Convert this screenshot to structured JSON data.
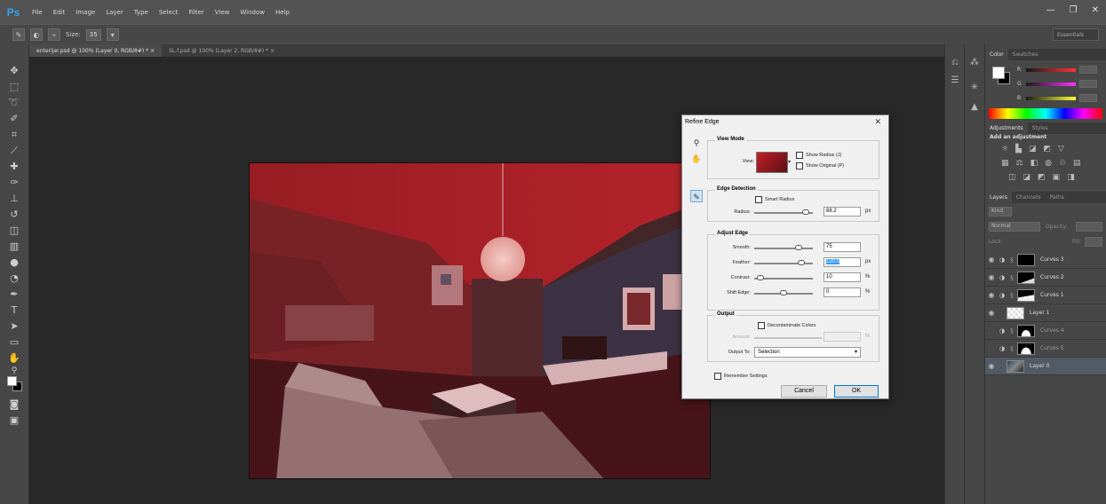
{
  "app": {
    "logo": "Ps",
    "menu": [
      "File",
      "Edit",
      "Image",
      "Layer",
      "Type",
      "Select",
      "Filter",
      "View",
      "Window",
      "Help"
    ],
    "window_controls": {
      "minimize": "—",
      "restore": "❐",
      "close": "✕"
    }
  },
  "options_bar": {
    "size_label": "Size:",
    "size_value": "35",
    "workspace": "Essentials"
  },
  "document_tabs": [
    {
      "label": "enterijer.psd @ 100% (Layer 0, RGB/8#) *",
      "close": "×"
    },
    {
      "label": "SL-f.psd @ 100% (Layer 2, RGB/8#) *",
      "close": "×"
    }
  ],
  "colors": {
    "foreground": "#ffffff",
    "background": "#000000",
    "accent_selection": "#3399ff",
    "overlay_red": "#c0202a"
  },
  "panels": {
    "color_tabs": [
      "Color",
      "Swatches"
    ],
    "color_channels": [
      "R",
      "G",
      "B"
    ],
    "adjustments_tabs": [
      "Adjustments",
      "Styles"
    ],
    "adjustments_title": "Add an adjustment",
    "layers_tabs": [
      "Layers",
      "Channels",
      "Paths"
    ],
    "kind_filter": "Kind",
    "blend_mode": "Normal",
    "opacity_label": "Opacity:",
    "lock_label": "Lock:",
    "fill_label": "Fill:",
    "layers": [
      {
        "name": "Curves 3",
        "visible": true
      },
      {
        "name": "Curves 2",
        "visible": true
      },
      {
        "name": "Curves 1",
        "visible": true
      },
      {
        "name": "Layer 1",
        "visible": true
      },
      {
        "name": "Curves 4",
        "visible": false
      },
      {
        "name": "Curves 5",
        "visible": false
      },
      {
        "name": "Layer 0",
        "visible": true,
        "selected": true
      }
    ]
  },
  "dialog": {
    "title": "Refine Edge",
    "close": "✕",
    "view_mode": {
      "title": "View Mode",
      "view_label": "View:",
      "show_radius": "Show Radius (J)",
      "show_original": "Show Original (P)"
    },
    "edge_detection": {
      "title": "Edge Detection",
      "smart_radius": "Smart Radius",
      "radius_label": "Radius:",
      "radius_value": "88.2",
      "radius_unit": "px",
      "radius_fraction": 0.88
    },
    "adjust_edge": {
      "title": "Adjust Edge",
      "smooth_label": "Smooth:",
      "smooth_value": "75",
      "smooth_fraction": 0.75,
      "feather_label": "Feather:",
      "feather_value": "120.0",
      "feather_unit": "px",
      "feather_fraction": 0.8,
      "contrast_label": "Contrast:",
      "contrast_value": "10",
      "contrast_unit": "%",
      "contrast_fraction": 0.1,
      "shift_label": "Shift Edge:",
      "shift_value": "0",
      "shift_unit": "%",
      "shift_fraction": 0.5
    },
    "output": {
      "title": "Output",
      "decontaminate": "Decontaminate Colors",
      "amount_label": "Amount:",
      "amount_unit": "%",
      "output_to_label": "Output To:",
      "output_to_value": "Selection"
    },
    "remember_settings": "Remember Settings",
    "cancel": "Cancel",
    "ok": "OK"
  }
}
